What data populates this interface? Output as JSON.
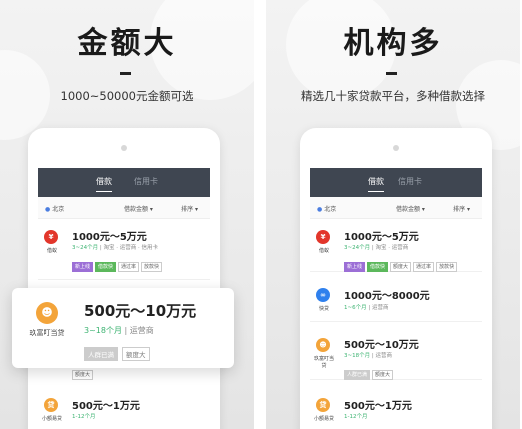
{
  "left": {
    "headline": "金额大",
    "subtitle": "1000~50000元金额可选",
    "tabs": [
      "借款",
      "信用卡"
    ],
    "filter": {
      "location": "北京",
      "sort_amount": "借款金额 ▾",
      "sort": "排序 ▾"
    },
    "items": [
      {
        "logo_name": "借蚁",
        "amount": "1000元～5万元",
        "term": "3~24个月",
        "extra": "| 淘宝 · 运营商 · 信用卡",
        "tags": [
          "新上线",
          "借款快",
          "通过率",
          "放款快"
        ]
      },
      {
        "logo_name": "小额易贷",
        "amount": "500元～1万元",
        "term": "1-12个月",
        "extra": "",
        "tags": []
      }
    ],
    "popup": {
      "logo_name": "玖富叮当贷",
      "amount": "500元～10万元",
      "term": "3~18个月",
      "extra": "| 运营商",
      "tags": [
        "人群已满",
        "额度大"
      ]
    },
    "hidden_tag": "额度大"
  },
  "right": {
    "headline": "机构多",
    "subtitle": "精选几十家贷款平台，多种借款选择",
    "tabs": [
      "借款",
      "信用卡"
    ],
    "filter": {
      "location": "北京",
      "sort_amount": "借款金额 ▾",
      "sort": "排序 ▾"
    },
    "items": [
      {
        "logo_name": "借蚁",
        "amount": "1000元～5万元",
        "term": "3~24个月",
        "extra": "| 淘宝 · 运营商",
        "tags": [
          "新上线",
          "借款快",
          "额度大",
          "通过率",
          "放款快"
        ]
      },
      {
        "logo_name": "快贷",
        "amount": "1000元～8000元",
        "term": "1~6个月",
        "extra": "| 运营商",
        "tags": []
      },
      {
        "logo_name": "玖富叮当贷",
        "amount": "500元～10万元",
        "term": "3~18个月",
        "extra": "| 运营商",
        "tags": [
          "人群已满",
          "额度大"
        ]
      },
      {
        "logo_name": "小额易贷",
        "amount": "500元～1万元",
        "term": "1-12个月",
        "extra": "",
        "tags": []
      }
    ]
  },
  "colors": {
    "appbar": "#3f4651",
    "accent_green": "#3cb371",
    "logo_red": "#e2362b",
    "logo_blue": "#2f80ed",
    "logo_orange": "#f3a43a"
  }
}
